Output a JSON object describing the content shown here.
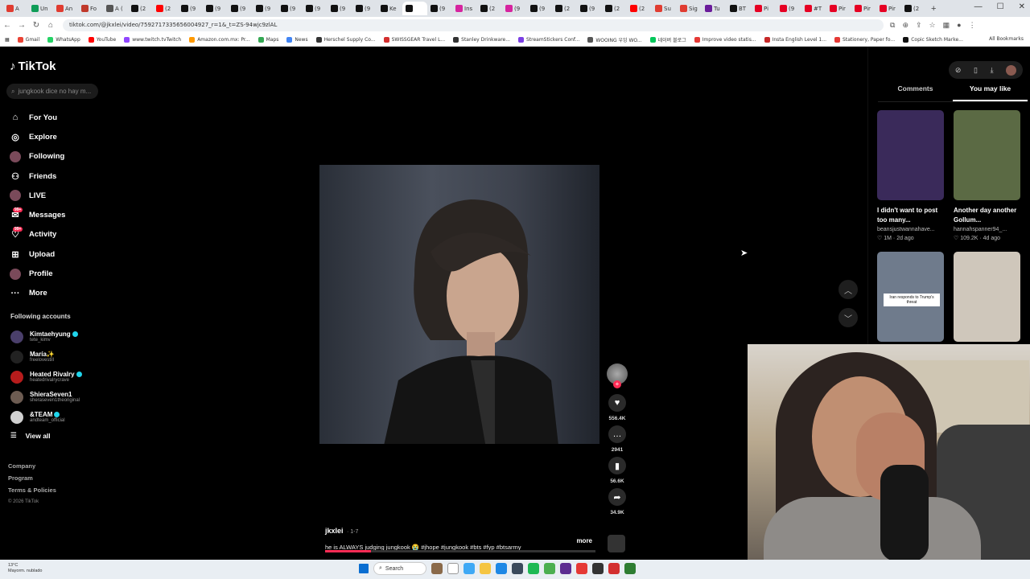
{
  "browser": {
    "tabs": [
      {
        "icon_color": "#e03c31",
        "label": "A"
      },
      {
        "icon_color": "#0f9d58",
        "label": "Un"
      },
      {
        "icon_color": "#e03c31",
        "label": "An"
      },
      {
        "icon_color": "#c0392b",
        "label": "Fo"
      },
      {
        "icon_color": "#555555",
        "label": "A ("
      },
      {
        "icon_color": "#111111",
        "label": "(2"
      },
      {
        "icon_color": "#ff0000",
        "label": "(2"
      },
      {
        "icon_color": "#111111",
        "label": "(9"
      },
      {
        "icon_color": "#111111",
        "label": "(9"
      },
      {
        "icon_color": "#111111",
        "label": "(9"
      },
      {
        "icon_color": "#111111",
        "label": "(9"
      },
      {
        "icon_color": "#111111",
        "label": "(9"
      },
      {
        "icon_color": "#111111",
        "label": "(9"
      },
      {
        "icon_color": "#111111",
        "label": "(9"
      },
      {
        "icon_color": "#111111",
        "label": "(9"
      },
      {
        "icon_color": "#111111",
        "label": "Ke"
      },
      {
        "icon_color": "#111111",
        "label": "",
        "active": true
      },
      {
        "icon_color": "#111111",
        "label": "(9"
      },
      {
        "icon_color": "#d6249f",
        "label": "Ins"
      },
      {
        "icon_color": "#111111",
        "label": "(2"
      },
      {
        "icon_color": "#d6249f",
        "label": "(9"
      },
      {
        "icon_color": "#111111",
        "label": "(9"
      },
      {
        "icon_color": "#111111",
        "label": "(2"
      },
      {
        "icon_color": "#111111",
        "label": "(9"
      },
      {
        "icon_color": "#111111",
        "label": "(2"
      },
      {
        "icon_color": "#ff0000",
        "label": "(2"
      },
      {
        "icon_color": "#e03c31",
        "label": "Su"
      },
      {
        "icon_color": "#e03c31",
        "label": "Sig"
      },
      {
        "icon_color": "#6a1b9a",
        "label": "Tu"
      },
      {
        "icon_color": "#111111",
        "label": "BT"
      },
      {
        "icon_color": "#e60023",
        "label": "Pi"
      },
      {
        "icon_color": "#e60023",
        "label": "(9"
      },
      {
        "icon_color": "#e60023",
        "label": "#T"
      },
      {
        "icon_color": "#e60023",
        "label": "Pir"
      },
      {
        "icon_color": "#e60023",
        "label": "Pir"
      },
      {
        "icon_color": "#e60023",
        "label": "Pir"
      },
      {
        "icon_color": "#111111",
        "label": "(2"
      }
    ],
    "url": "tiktok.com/@jkxlei/video/7592717335656004927_r=1&_t=ZS-94wjc9zlAL",
    "bookmarks": [
      {
        "label": "Gmail",
        "color": "#ea4335"
      },
      {
        "label": "WhatsApp",
        "color": "#25d366"
      },
      {
        "label": "YouTube",
        "color": "#ff0000"
      },
      {
        "label": "www.twitch.tvTwitch",
        "color": "#9146ff"
      },
      {
        "label": "Amazon.com.mx: Pr...",
        "color": "#ff9900"
      },
      {
        "label": "Maps",
        "color": "#34a853"
      },
      {
        "label": "News",
        "color": "#4285f4"
      },
      {
        "label": "Herschel Supply Co...",
        "color": "#333333"
      },
      {
        "label": "SWISSGEAR Travel L...",
        "color": "#d32f2f"
      },
      {
        "label": "Stanley Drinkware...",
        "color": "#333333"
      },
      {
        "label": "StreamStickers Conf...",
        "color": "#7b3fe4"
      },
      {
        "label": "WOOING 우잉 WO...",
        "color": "#555555"
      },
      {
        "label": "네이버 블로그",
        "color": "#03c75a"
      },
      {
        "label": "Improve video statis...",
        "color": "#e53935"
      },
      {
        "label": "Insta English Level 1...",
        "color": "#c62828"
      },
      {
        "label": "Stationery, Paper fo...",
        "color": "#e53935"
      },
      {
        "label": "Copic Sketch Marke...",
        "color": "#111111"
      }
    ],
    "all_bookmarks": "All Bookmarks"
  },
  "sidebar": {
    "logo": "TikTok",
    "search_placeholder": "jungkook dice no hay m...",
    "nav": [
      {
        "label": "For You",
        "icon": "home-icon"
      },
      {
        "label": "Explore",
        "icon": "compass-icon"
      },
      {
        "label": "Following",
        "icon": "avatar-icon"
      },
      {
        "label": "Friends",
        "icon": "friends-icon"
      },
      {
        "label": "LIVE",
        "icon": "avatar-icon"
      },
      {
        "label": "Messages",
        "icon": "message-icon",
        "badge": "99+"
      },
      {
        "label": "Activity",
        "icon": "bell-icon",
        "badge": "99+"
      },
      {
        "label": "Upload",
        "icon": "plus-square-icon"
      },
      {
        "label": "Profile",
        "icon": "avatar-icon"
      },
      {
        "label": "More",
        "icon": "more-icon"
      }
    ],
    "following_title": "Following accounts",
    "accounts": [
      {
        "name": "Kimtaehyung",
        "handle": "tete_kimv",
        "verified": true,
        "color": "#4a3f6b"
      },
      {
        "name": "María",
        "name_emoji": "✨",
        "handle": "freelovestill",
        "verified": false,
        "color": "#222222"
      },
      {
        "name": "Heated Rivalry",
        "handle": "heatedrivalrycrave",
        "verified": true,
        "color": "#b71c1c"
      },
      {
        "name": "ShieraSeven1",
        "handle": "sheraseven1theoriginal",
        "verified": false,
        "color": "#6d5c52"
      },
      {
        "name": "&TEAM",
        "handle": "andteam_official",
        "verified": true,
        "color": "#d0d0d0"
      }
    ],
    "view_all": "View all",
    "footer": [
      "Company",
      "Program",
      "Terms & Policies"
    ],
    "copyright": "© 2026 TikTok"
  },
  "video": {
    "likes": "556.4K",
    "comments": "2941",
    "saves": "56.6K",
    "shares": "34.9K",
    "username": "jkxlei",
    "date": "· 1-7",
    "caption": "he is ALWAYS judging jungkook 😭 #jhope #jungkook #bts #fyp #btsarmy",
    "more": "more",
    "progress": 0.17
  },
  "right_panel": {
    "tabs": [
      "Comments",
      "You may like"
    ],
    "active_tab": "You may like",
    "cards": [
      {
        "title": "I didn't want to post too many...",
        "user": "beansjustwannahave...",
        "likes": "1M",
        "age": "2d ago",
        "color": "#3a2a5a"
      },
      {
        "title": "Another day another Gollum...",
        "user": "hannahspanner94_...",
        "likes": "109.2K",
        "age": "4d ago",
        "color": "#5b6a44"
      },
      {
        "title": "",
        "user": "",
        "likes": "",
        "age": "",
        "color": "#6f7b8c",
        "overlay": "Iran responds to Trump's threat"
      },
      {
        "title": "",
        "user": "",
        "likes": "",
        "age": "",
        "color": "#cfc7bb"
      }
    ]
  },
  "taskbar": {
    "weather_temp": "13°C",
    "weather_desc": "Mayorm. nublado",
    "search": "Search"
  },
  "colors": {
    "accent": "#fe2c55",
    "verified": "#20d5ec"
  }
}
